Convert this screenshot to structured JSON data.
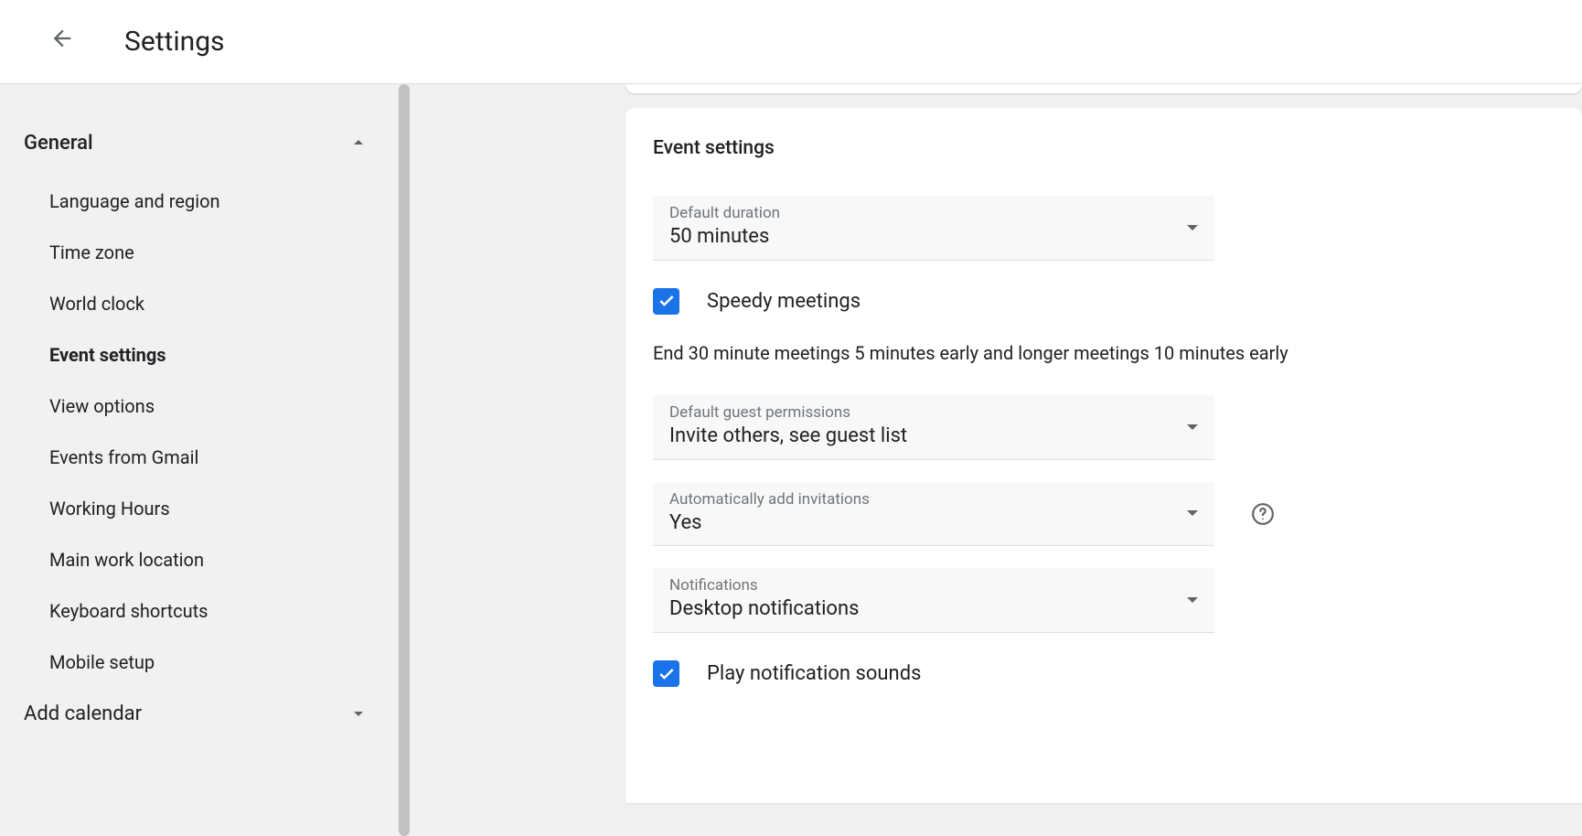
{
  "header": {
    "title": "Settings"
  },
  "sidebar": {
    "section1": {
      "title": "General",
      "expanded": true
    },
    "items": [
      {
        "label": "Language and region"
      },
      {
        "label": "Time zone"
      },
      {
        "label": "World clock"
      },
      {
        "label": "Event settings"
      },
      {
        "label": "View options"
      },
      {
        "label": "Events from Gmail"
      },
      {
        "label": "Working Hours"
      },
      {
        "label": "Main work location"
      },
      {
        "label": "Keyboard shortcuts"
      },
      {
        "label": "Mobile setup"
      }
    ],
    "section2": {
      "title": "Add calendar",
      "expanded": false
    }
  },
  "main": {
    "card_title": "Event settings",
    "default_duration": {
      "label": "Default duration",
      "value": "50 minutes"
    },
    "speedy_label": "Speedy meetings",
    "speedy_desc": "End 30 minute meetings 5 minutes early and longer meetings 10 minutes early",
    "guest_perm": {
      "label": "Default guest permissions",
      "value": "Invite others, see guest list"
    },
    "auto_add": {
      "label": "Automatically add invitations",
      "value": "Yes"
    },
    "notifications": {
      "label": "Notifications",
      "value": "Desktop notifications"
    },
    "play_sounds_label": "Play notification sounds"
  },
  "colors": {
    "accent": "#1a73e8"
  }
}
